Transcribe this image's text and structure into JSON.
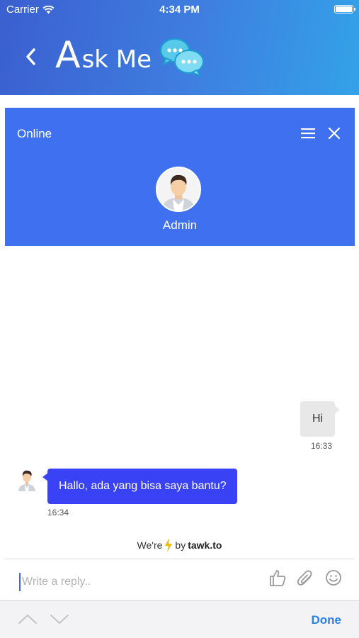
{
  "status_bar": {
    "carrier": "Carrier",
    "time": "4:34 PM"
  },
  "app_header": {
    "title_initial": "A",
    "title_rest": "sk Me",
    "colors": {
      "gradient_start": "#3b5fd0",
      "gradient_end": "#33a2e8"
    }
  },
  "widget": {
    "status": "Online",
    "agent_name": "Admin",
    "accent": "#3e70f0"
  },
  "messages": [
    {
      "from": "visitor",
      "text": "Hi",
      "time": "16:33"
    },
    {
      "from": "agent",
      "text": "Hallo, ada yang bisa saya bantu?",
      "time": "16:34"
    }
  ],
  "footer": {
    "powered_prefix": "We're",
    "powered_by": "by",
    "brand": "tawk.to",
    "reply_placeholder": "Write a reply..",
    "tools": [
      "thumbs-up-icon",
      "paperclip-icon",
      "smiley-icon"
    ]
  },
  "keyboard_bar": {
    "done_label": "Done"
  }
}
